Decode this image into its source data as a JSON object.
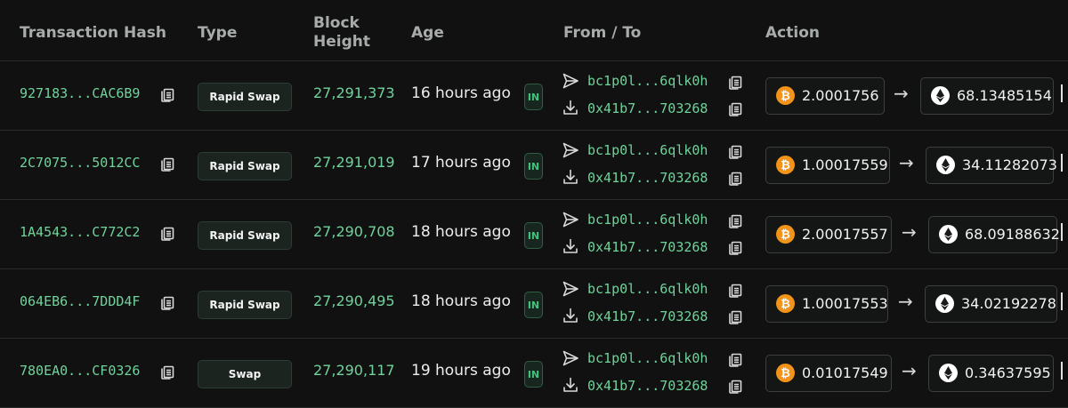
{
  "headers": {
    "hash": "Transaction Hash",
    "type": "Type",
    "block": "Block\nHeight",
    "age": "Age",
    "from_to": "From / To",
    "action": "Action"
  },
  "icons": {
    "copy": "copy-icon",
    "send": "send-icon",
    "receive": "download-icon",
    "btc": "bitcoin-icon",
    "eth": "ethereum-icon"
  },
  "colors": {
    "background": "#111111",
    "accent_green": "#6fd39b",
    "btc_orange": "#f2931a"
  },
  "rows": [
    {
      "hash": "927183...CAC6B9",
      "type": "Rapid Swap",
      "block": "27,291,373",
      "age": "16 hours ago",
      "direction": "IN",
      "from": "bc1p0l...6qlk0h",
      "to": "0x41b7...703268",
      "from_amount": "2.0001756",
      "arrow": "→",
      "to_amount": "68.13485154"
    },
    {
      "hash": "2C7075...5012CC",
      "type": "Rapid Swap",
      "block": "27,291,019",
      "age": "17 hours ago",
      "direction": "IN",
      "from": "bc1p0l...6qlk0h",
      "to": "0x41b7...703268",
      "from_amount": "1.00017559",
      "arrow": "→",
      "to_amount": "34.11282073"
    },
    {
      "hash": "1A4543...C772C2",
      "type": "Rapid Swap",
      "block": "27,290,708",
      "age": "18 hours ago",
      "direction": "IN",
      "from": "bc1p0l...6qlk0h",
      "to": "0x41b7...703268",
      "from_amount": "2.00017557",
      "arrow": "→",
      "to_amount": "68.09188632"
    },
    {
      "hash": "064EB6...7DDD4F",
      "type": "Rapid Swap",
      "block": "27,290,495",
      "age": "18 hours ago",
      "direction": "IN",
      "from": "bc1p0l...6qlk0h",
      "to": "0x41b7...703268",
      "from_amount": "1.00017553",
      "arrow": "→",
      "to_amount": "34.02192278"
    },
    {
      "hash": "780EA0...CF0326",
      "type": "Swap",
      "block": "27,290,117",
      "age": "19 hours ago",
      "direction": "IN",
      "from": "bc1p0l...6qlk0h",
      "to": "0x41b7...703268",
      "from_amount": "0.01017549",
      "arrow": "→",
      "to_amount": "0.34637595"
    }
  ]
}
